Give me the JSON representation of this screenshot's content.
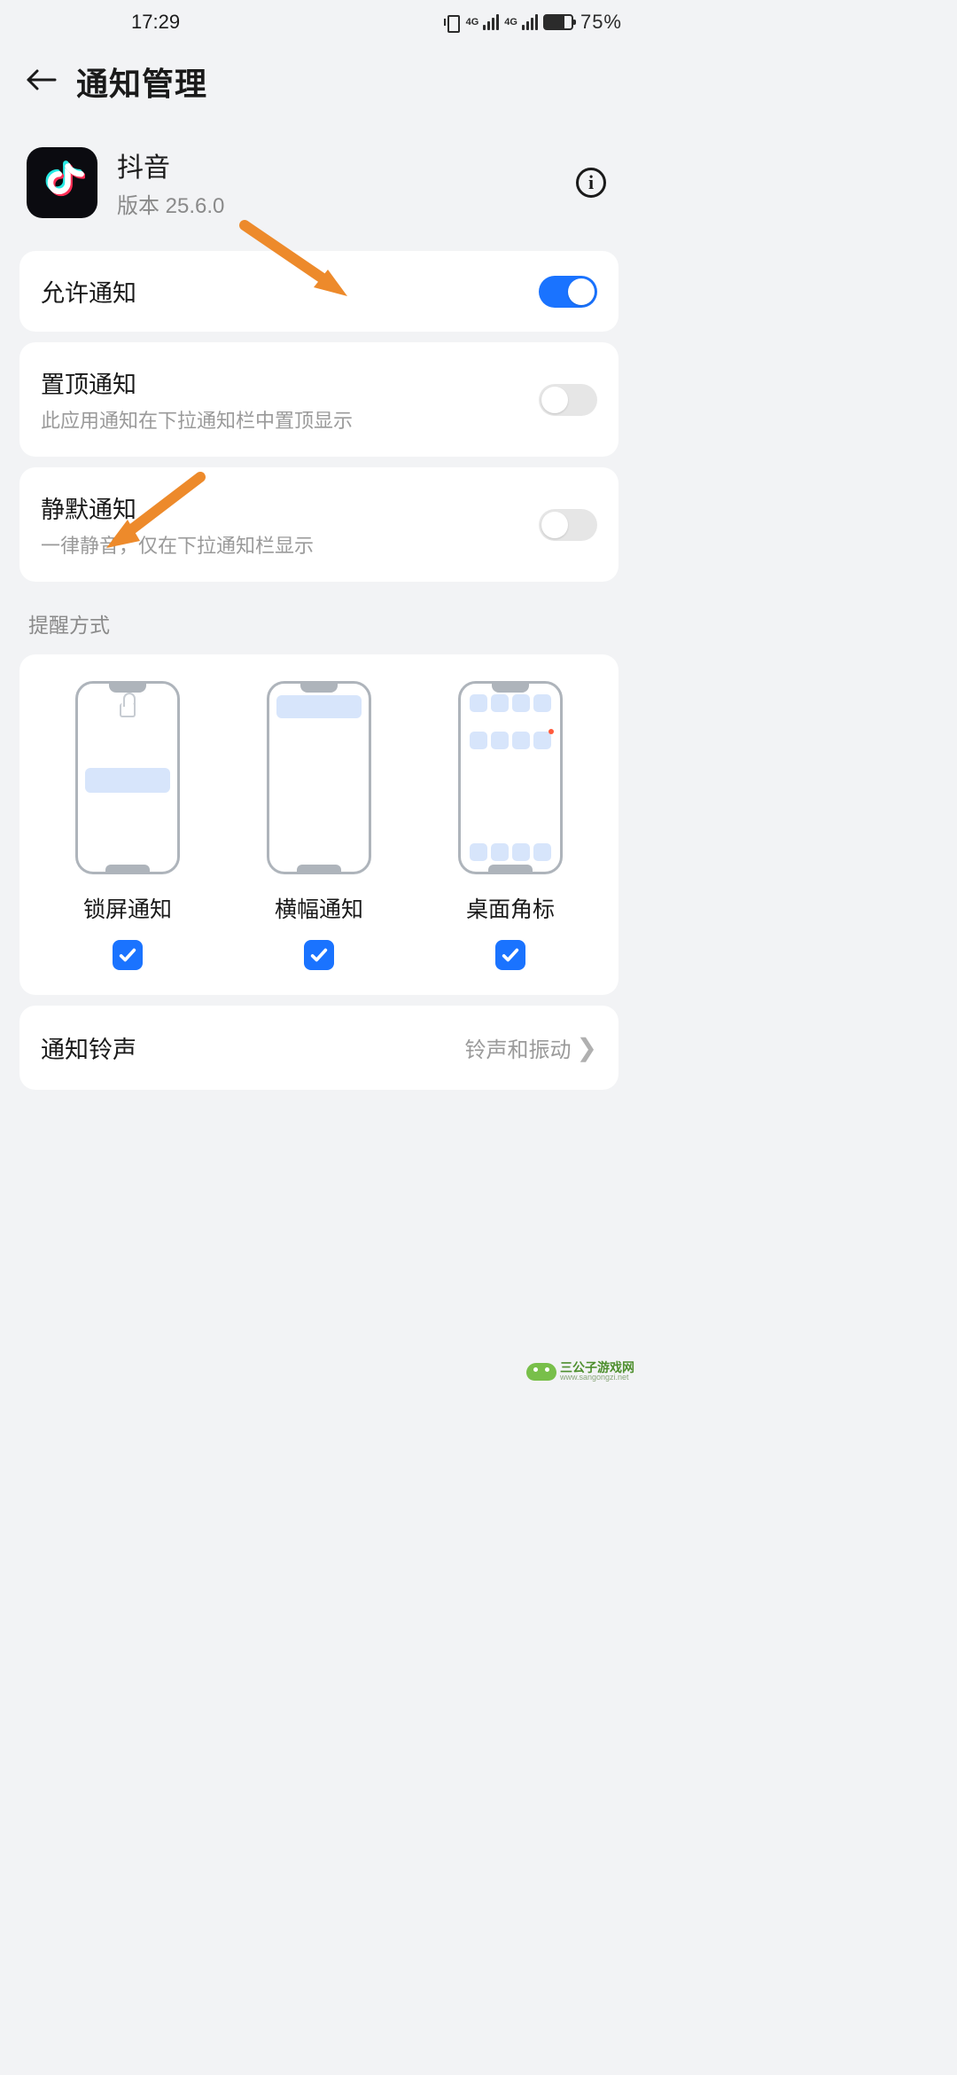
{
  "status": {
    "time": "17:29",
    "battery_percent": "75%",
    "signal_label": "4G"
  },
  "header": {
    "title": "通知管理"
  },
  "app": {
    "name": "抖音",
    "version_prefix": "版本 ",
    "version": "25.6.0"
  },
  "settings": {
    "allow": {
      "label": "允许通知",
      "on": true
    },
    "pin": {
      "label": "置顶通知",
      "sub": "此应用通知在下拉通知栏中置顶显示",
      "on": false
    },
    "silent": {
      "label": "静默通知",
      "sub": "一律静音，仅在下拉通知栏显示",
      "on": false
    }
  },
  "section": {
    "alert_modes": "提醒方式"
  },
  "alerts": {
    "lock": {
      "label": "锁屏通知",
      "checked": true
    },
    "banner": {
      "label": "横幅通知",
      "checked": true
    },
    "badge": {
      "label": "桌面角标",
      "checked": true
    }
  },
  "ringtone": {
    "label": "通知铃声",
    "value": "铃声和振动"
  },
  "watermark": {
    "name": "三公子游戏网",
    "url": "www.sangongzi.net"
  }
}
